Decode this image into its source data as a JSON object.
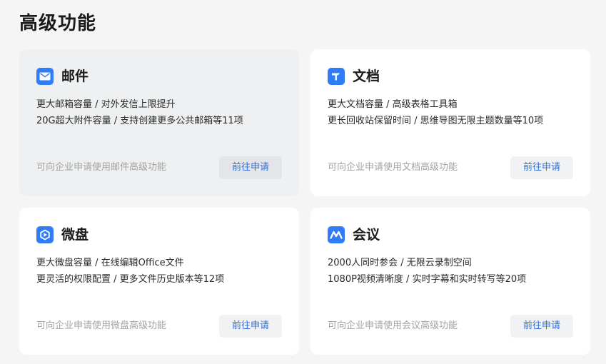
{
  "page": {
    "title": "高级功能"
  },
  "colors": {
    "accent": "#2f7cf6",
    "link": "#2f6fd6",
    "muted": "#a3a3a3"
  },
  "cards": [
    {
      "icon": "mail-icon",
      "title": "邮件",
      "line1": "更大邮箱容量 / 对外发信上限提升",
      "line2": "20G超大附件容量 / 支持创建更多公共邮箱等11项",
      "note": "可向企业申请使用邮件高级功能",
      "button": "前往申请"
    },
    {
      "icon": "document-icon",
      "title": "文档",
      "line1": "更大文档容量 / 高级表格工具箱",
      "line2": "更长回收站保留时间 / 思维导图无限主题数量等10项",
      "note": "可向企业申请使用文档高级功能",
      "button": "前往申请"
    },
    {
      "icon": "drive-icon",
      "title": "微盘",
      "line1": "更大微盘容量 / 在线编辑Office文件",
      "line2": "更灵活的权限配置 / 更多文件历史版本等12项",
      "note": "可向企业申请使用微盘高级功能",
      "button": "前往申请"
    },
    {
      "icon": "meeting-icon",
      "title": "会议",
      "line1": "2000人同时参会 / 无限云录制空间",
      "line2": "1080P视频清晰度 / 实时字幕和实时转写等20项",
      "note": "可向企业申请使用会议高级功能",
      "button": "前往申请"
    }
  ]
}
